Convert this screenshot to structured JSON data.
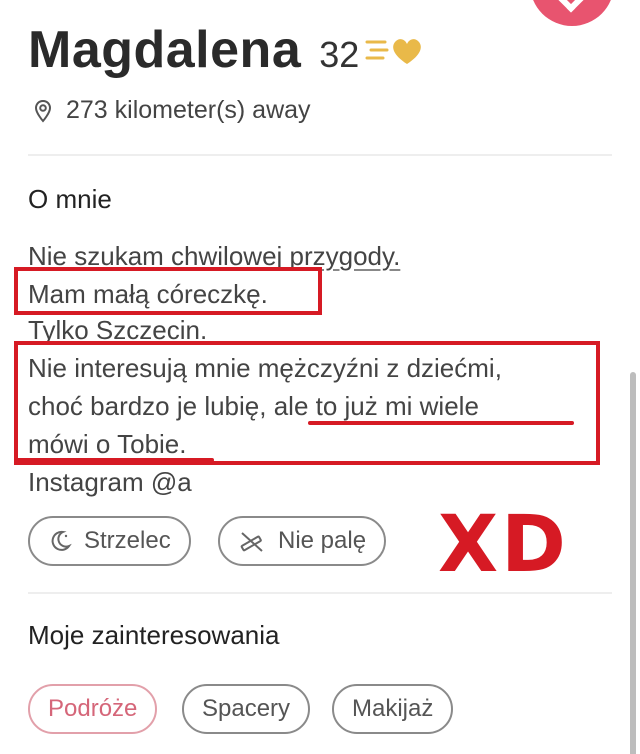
{
  "profile": {
    "name": "Magdalena",
    "age": "32",
    "distance": "273 kilometer(s) away"
  },
  "about": {
    "title": "O mnie",
    "lines": [
      "Nie szukam chwilowej przygody.",
      "Mam małą córeczkę.",
      "Tylko Szczecin.",
      "Nie interesują mnie mężczyźni z dziećmi,",
      "choć bardzo je lubię, ale to już mi wiele",
      "mówi o Tobie.",
      "Instagram @a"
    ]
  },
  "attributes": [
    {
      "label": "Strzelec",
      "icon": "moon-icon"
    },
    {
      "label": "Nie palę",
      "icon": "no-smoking-icon"
    }
  ],
  "annotation": {
    "text": "XD",
    "color": "#d61a24"
  },
  "interests": {
    "title": "Moje zainteresowania",
    "items": [
      "Podróże",
      "Spacery",
      "Makijaż"
    ]
  },
  "colors": {
    "accent": "#e8546f",
    "annotation_red": "#d61a24",
    "gold": "#e9b949"
  }
}
